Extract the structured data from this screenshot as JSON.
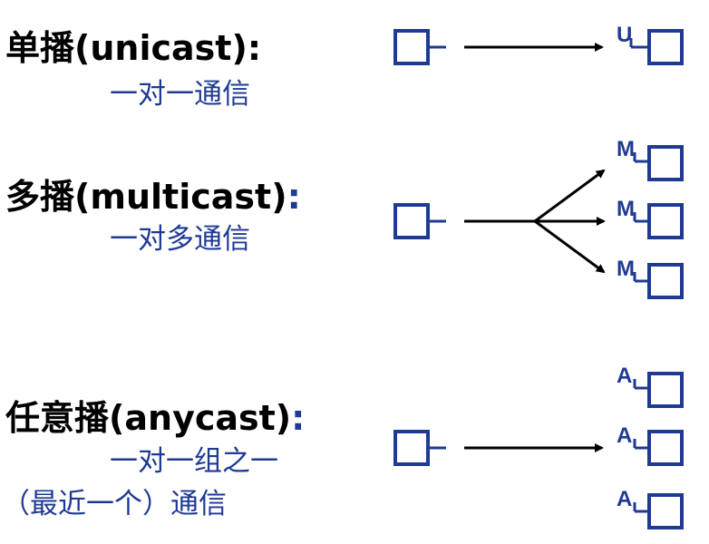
{
  "unicast": {
    "title_cn": "单播",
    "title_en": "(unicast)",
    "colon": ":",
    "subtitle": "一对一通信",
    "host_label": "U"
  },
  "multicast": {
    "title_cn": "多播",
    "title_en": "(multicast)",
    "colon": ":",
    "subtitle": "一对多通信",
    "host_label": "M"
  },
  "anycast": {
    "title_cn": "任意播",
    "title_en": "(anycast)",
    "colon": ":",
    "subtitle_line1": "一对一组之一",
    "subtitle_line2": "（最近一个）通信",
    "host_label": "A"
  },
  "colors": {
    "accent_blue": "#1f3a93",
    "arrow_black": "#000000"
  }
}
